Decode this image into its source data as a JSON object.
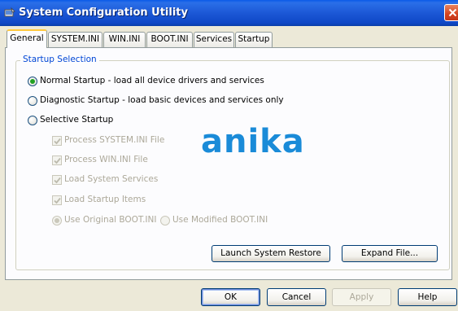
{
  "window": {
    "title": "System Configuration Utility",
    "title_icon": "msconfig-icon",
    "close_icon": "close-icon"
  },
  "tabs": [
    {
      "label": "General",
      "active": true
    },
    {
      "label": "SYSTEM.INI",
      "active": false
    },
    {
      "label": "WIN.INI",
      "active": false
    },
    {
      "label": "BOOT.INI",
      "active": false
    },
    {
      "label": "Services",
      "active": false
    },
    {
      "label": "Startup",
      "active": false
    }
  ],
  "startup_selection": {
    "title": "Startup Selection",
    "options": [
      {
        "label": "Normal Startup - load all device drivers and services",
        "selected": true
      },
      {
        "label": "Diagnostic Startup - load basic devices and services only",
        "selected": false
      },
      {
        "label": "Selective Startup",
        "selected": false
      }
    ],
    "selective": {
      "checkboxes": [
        {
          "label": "Process SYSTEM.INI File",
          "checked": true,
          "enabled": false
        },
        {
          "label": "Process WIN.INI File",
          "checked": true,
          "enabled": false
        },
        {
          "label": "Load System Services",
          "checked": true,
          "enabled": false
        },
        {
          "label": "Load Startup Items",
          "checked": true,
          "enabled": false
        }
      ],
      "boot_options": [
        {
          "label": "Use Original BOOT.INI",
          "selected": true,
          "enabled": false
        },
        {
          "label": "Use Modified BOOT.INI",
          "selected": false,
          "enabled": false
        }
      ]
    },
    "launch_restore_label": "Launch System Restore",
    "expand_file_label": "Expand File..."
  },
  "watermark": "anika",
  "footer": {
    "ok_label": "OK",
    "cancel_label": "Cancel",
    "apply_label": "Apply",
    "apply_enabled": false,
    "help_label": "Help"
  },
  "colors": {
    "title_bar": "#0a5ae8",
    "group_title": "#0046d5",
    "radio_selected": "#21a121",
    "watermark": "#1a8bd8",
    "active_tab_accent": "#ffc83c",
    "close_button": "#d5431e"
  }
}
